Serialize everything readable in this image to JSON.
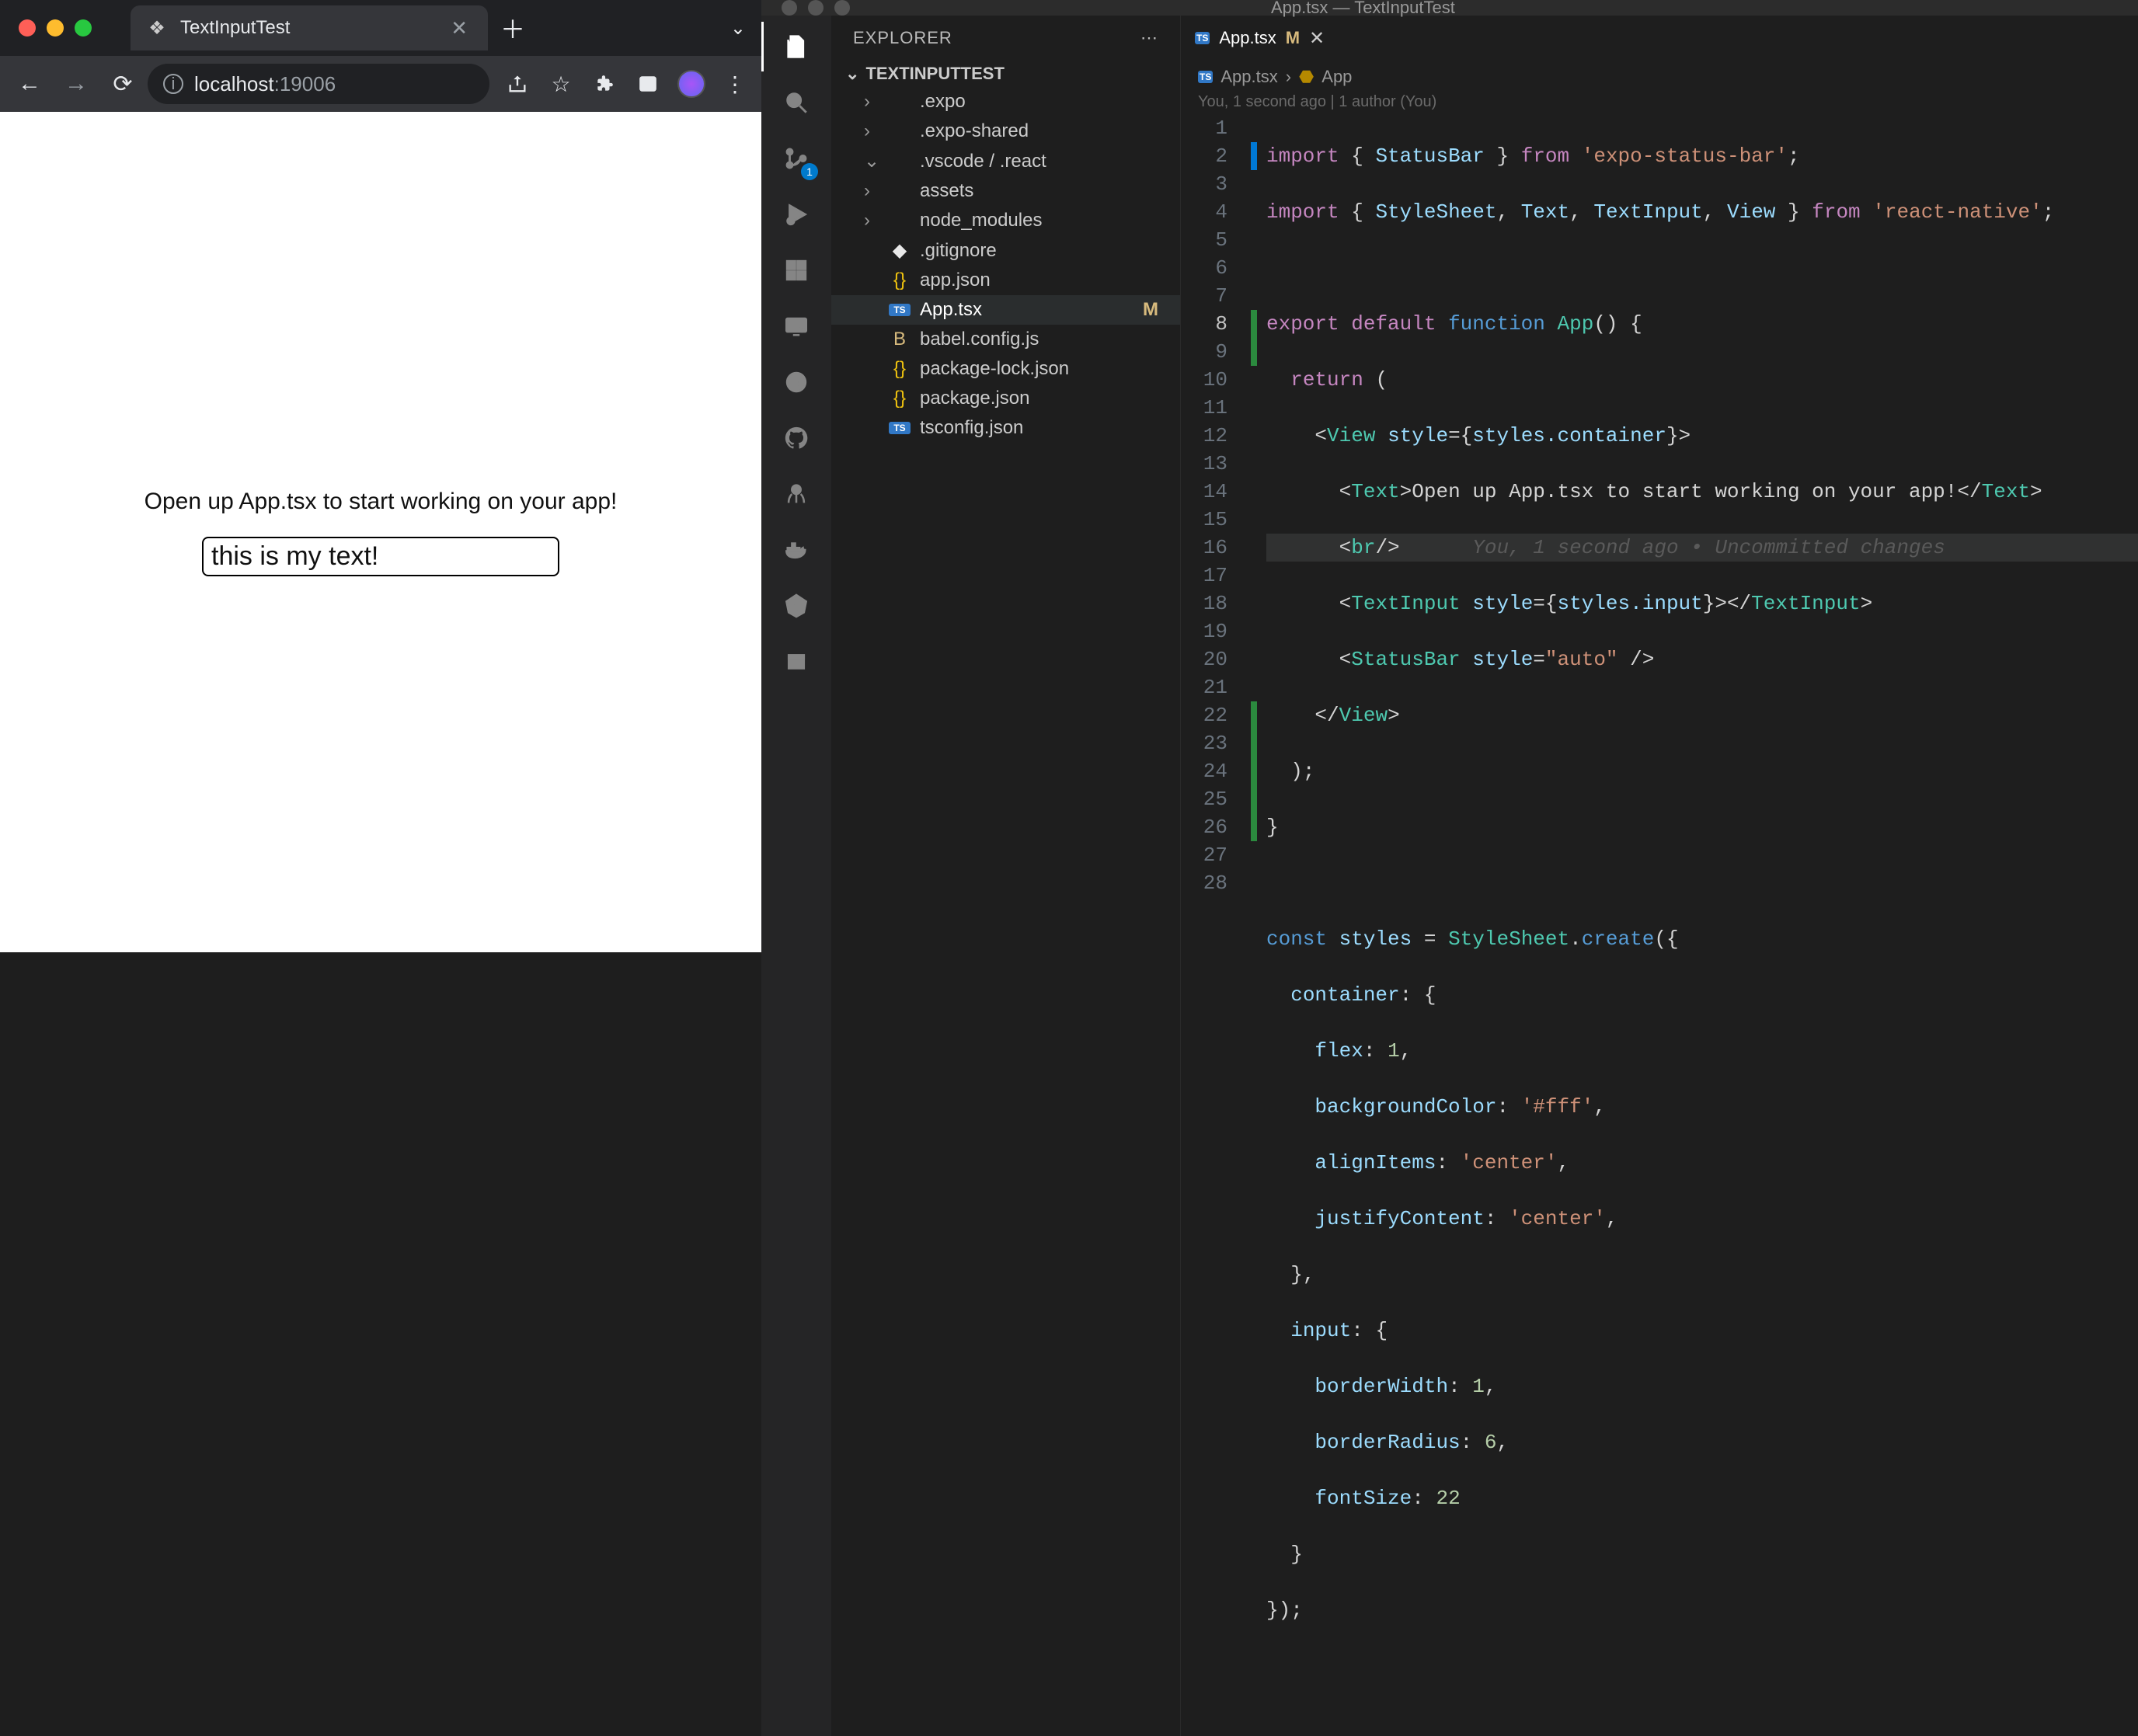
{
  "browser": {
    "tab_title": "TextInputTest",
    "host": "localhost",
    "port": ":19006"
  },
  "app": {
    "text": "Open up App.tsx to start working on your app!",
    "input_value": "this is my text!"
  },
  "vscode": {
    "window_title": "App.tsx — TextInputTest",
    "explorer_label": "EXPLORER",
    "root_name": "TEXTINPUTTEST",
    "source_control_badge": "1",
    "tree": [
      {
        "name": ".expo",
        "type": "folder"
      },
      {
        "name": ".expo-shared",
        "type": "folder"
      },
      {
        "name": ".vscode / .react",
        "type": "folder",
        "expanded": true
      },
      {
        "name": "assets",
        "type": "folder"
      },
      {
        "name": "node_modules",
        "type": "folder"
      },
      {
        "name": ".gitignore",
        "type": "file",
        "icon": "git"
      },
      {
        "name": "app.json",
        "type": "file",
        "icon": "json"
      },
      {
        "name": "App.tsx",
        "type": "file",
        "icon": "ts",
        "status": "M",
        "selected": true
      },
      {
        "name": "babel.config.js",
        "type": "file",
        "icon": "js"
      },
      {
        "name": "package-lock.json",
        "type": "file",
        "icon": "json"
      },
      {
        "name": "package.json",
        "type": "file",
        "icon": "json"
      },
      {
        "name": "tsconfig.json",
        "type": "file",
        "icon": "ts"
      }
    ],
    "tab": {
      "name": "App.tsx",
      "status": "M"
    },
    "breadcrumb": {
      "file": "App.tsx",
      "symbol": "App"
    },
    "authorship": "You, 1 second ago | 1 author (You)",
    "blame": "You, 1 second ago • Uncommitted changes",
    "code": {
      "line_count": 28,
      "current_line": 8,
      "tokens": {
        "l1_import": "import",
        "l1_StatusBar": "StatusBar",
        "l1_from": "from",
        "l1_pkg": "'expo-status-bar'",
        "l2_import": "import",
        "l2_StyleSheet": "StyleSheet",
        "l2_Text": "Text",
        "l2_TextInput": "TextInput",
        "l2_View": "View",
        "l2_from": "from",
        "l2_pkg": "'react-native'",
        "l4_export": "export",
        "l4_default": "default",
        "l4_function": "function",
        "l4_App": "App",
        "l5_return": "return",
        "l6_View": "View",
        "l6_style": "style",
        "l6_container": "styles.container",
        "l7_Text": "Text",
        "l7_text": "Open up App.tsx to start working on your app!",
        "l8_br": "br",
        "l9_TextInput": "TextInput",
        "l9_style": "style",
        "l9_input": "styles.input",
        "l10_StatusBar": "StatusBar",
        "l10_style": "style",
        "l10_val": "\"auto\"",
        "l11_View": "View",
        "l15_const": "const",
        "l15_styles": "styles",
        "l15_StyleSheet": "StyleSheet",
        "l15_create": "create",
        "l16_container": "container",
        "l17_flex": "flex",
        "l17_val": "1",
        "l18_bg": "backgroundColor",
        "l18_val": "'#fff'",
        "l19_align": "alignItems",
        "l19_val": "'center'",
        "l20_justify": "justifyContent",
        "l20_val": "'center'",
        "l22_input": "input",
        "l23_bw": "borderWidth",
        "l23_val": "1",
        "l24_br": "borderRadius",
        "l24_val": "6",
        "l25_fs": "fontSize",
        "l25_val": "22"
      }
    }
  }
}
